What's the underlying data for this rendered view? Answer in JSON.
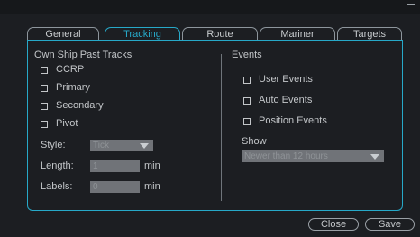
{
  "tabs": [
    {
      "label": "General"
    },
    {
      "label": "Tracking"
    },
    {
      "label": "Route"
    },
    {
      "label": "Mariner"
    },
    {
      "label": "Targets"
    }
  ],
  "own_ship": {
    "heading": "Own Ship Past Tracks",
    "options": [
      {
        "label": "CCRP",
        "checked": false
      },
      {
        "label": "Primary",
        "checked": false
      },
      {
        "label": "Secondary",
        "checked": false
      },
      {
        "label": "Pivot",
        "checked": false
      }
    ],
    "style_label": "Style:",
    "style_value": "Tick",
    "length_label": "Length:",
    "length_value": "1",
    "length_unit": "min",
    "labels_label": "Labels:",
    "labels_value": "0",
    "labels_unit": "min"
  },
  "events": {
    "heading": "Events",
    "options": [
      {
        "label": "User Events",
        "checked": false
      },
      {
        "label": "Auto Events",
        "checked": false
      },
      {
        "label": "Position Events",
        "checked": false
      }
    ],
    "show_label": "Show",
    "show_value": "Newer than 12 hours"
  },
  "buttons": {
    "close": "Close",
    "save": "Save"
  },
  "colors": {
    "accent": "#27a9c9",
    "background": "#1c1e22",
    "field": "#707378"
  }
}
